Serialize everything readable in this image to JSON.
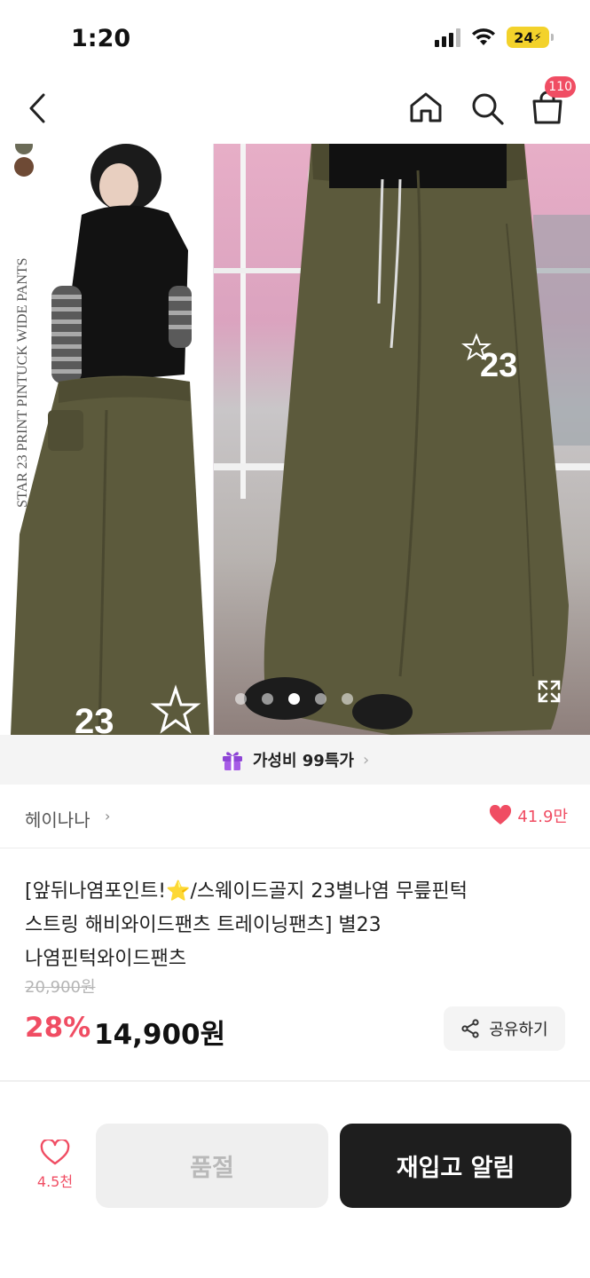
{
  "status_bar": {
    "time": "1:20",
    "battery": "24"
  },
  "nav": {
    "back_icon": "chevron-left-icon",
    "home_icon": "home-icon",
    "search_icon": "search-icon",
    "cart_icon": "shopping-bag-icon",
    "cart_count": "110"
  },
  "gallery": {
    "vertical_caption": "STAR 23 PRINT PINTUCK WIDE PANTS",
    "print_number": "23",
    "current_index": 3,
    "total": 5,
    "expand_icon": "expand-icon"
  },
  "promo": {
    "icon": "gift-icon",
    "label": "가성비 99특가"
  },
  "seller": {
    "name": "헤이나나",
    "likes": "41.9만"
  },
  "product": {
    "title_line1": "[앞뒤나염포인트!⭐/스웨이드골지 23별나염 무릎핀턱",
    "title_line2": "스트링 해비와이드팬츠 트레이닝팬츠] 별23",
    "title_line3": "나염핀턱와이드팬츠",
    "original_price": "20,900원",
    "discount": "28%",
    "price": "14,900원",
    "share_label": "공유하기"
  },
  "bottom_bar": {
    "wish_count": "4.5천",
    "soldout_label": "품절",
    "restock_label": "재입고 알림"
  },
  "colors": {
    "accent": "#f04d63",
    "dark_button": "#1e1e1e",
    "pants_olive": "#5c5a3c"
  }
}
